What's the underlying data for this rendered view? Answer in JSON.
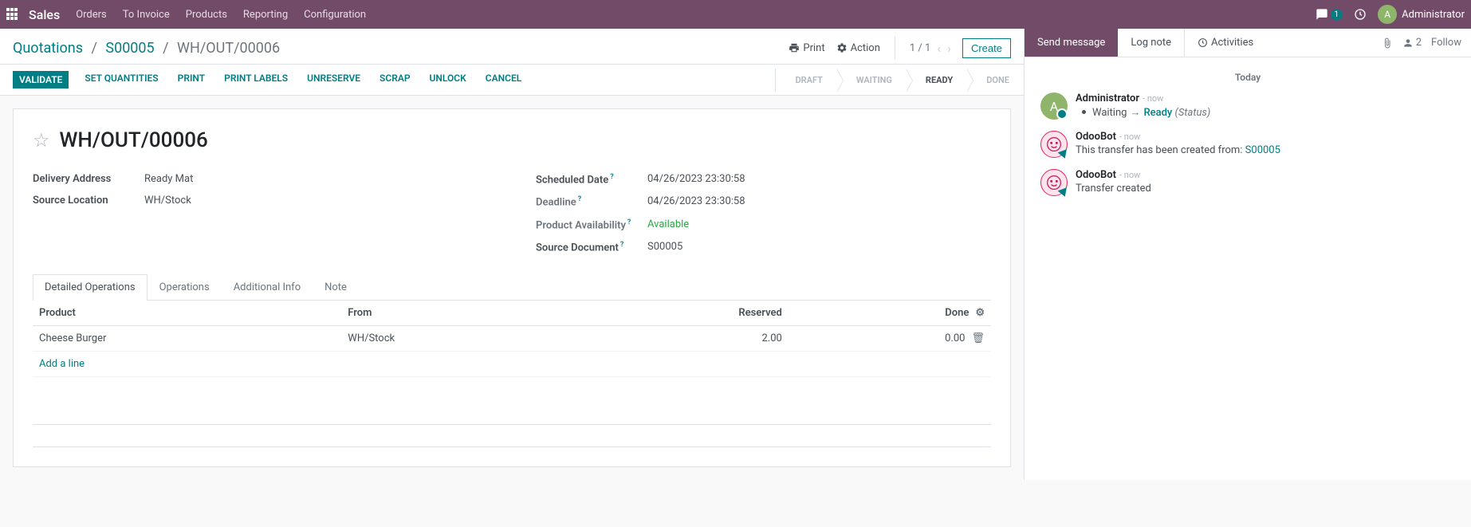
{
  "topnav": {
    "brand": "Sales",
    "items": [
      "Orders",
      "To Invoice",
      "Products",
      "Reporting",
      "Configuration"
    ],
    "messages_badge": "1",
    "user_initial": "A",
    "user_name": "Administrator"
  },
  "breadcrumb": {
    "root": "Quotations",
    "parent": "S00005",
    "current": "WH/OUT/00006"
  },
  "cp": {
    "print": "Print",
    "action": "Action",
    "pager": "1 / 1",
    "create": "Create"
  },
  "statusbar": {
    "buttons": [
      "VALIDATE",
      "SET QUANTITIES",
      "PRINT",
      "PRINT LABELS",
      "UNRESERVE",
      "SCRAP",
      "UNLOCK",
      "CANCEL"
    ],
    "steps": [
      "DRAFT",
      "WAITING",
      "READY",
      "DONE"
    ],
    "active_step": "READY"
  },
  "record": {
    "title": "WH/OUT/00006",
    "left": {
      "delivery_address_label": "Delivery Address",
      "delivery_address": "Ready Mat",
      "source_location_label": "Source Location",
      "source_location": "WH/Stock"
    },
    "right": {
      "scheduled_date_label": "Scheduled Date",
      "scheduled_date": "04/26/2023 23:30:58",
      "deadline_label": "Deadline",
      "deadline": "04/26/2023 23:30:58",
      "availability_label": "Product Availability",
      "availability": "Available",
      "source_doc_label": "Source Document",
      "source_doc": "S00005"
    }
  },
  "tabs": [
    "Detailed Operations",
    "Operations",
    "Additional Info",
    "Note"
  ],
  "table": {
    "headers": {
      "product": "Product",
      "from": "From",
      "reserved": "Reserved",
      "done": "Done"
    },
    "rows": [
      {
        "product": "Cheese Burger",
        "from": "WH/Stock",
        "reserved": "2.00",
        "done": "0.00"
      }
    ],
    "add_line": "Add a line"
  },
  "chatter": {
    "send": "Send message",
    "log": "Log note",
    "activities": "Activities",
    "followers": "2",
    "follow": "Follow",
    "today": "Today",
    "messages": [
      {
        "type": "admin",
        "name": "Administrator",
        "time": "now",
        "kind": "status",
        "from": "Waiting",
        "to": "Ready",
        "label": "(Status)"
      },
      {
        "type": "bot",
        "name": "OdooBot",
        "time": "now",
        "kind": "text",
        "text": "This transfer has been created from: ",
        "link": "S00005"
      },
      {
        "type": "bot",
        "name": "OdooBot",
        "time": "now",
        "kind": "plain",
        "text": "Transfer created"
      }
    ]
  }
}
